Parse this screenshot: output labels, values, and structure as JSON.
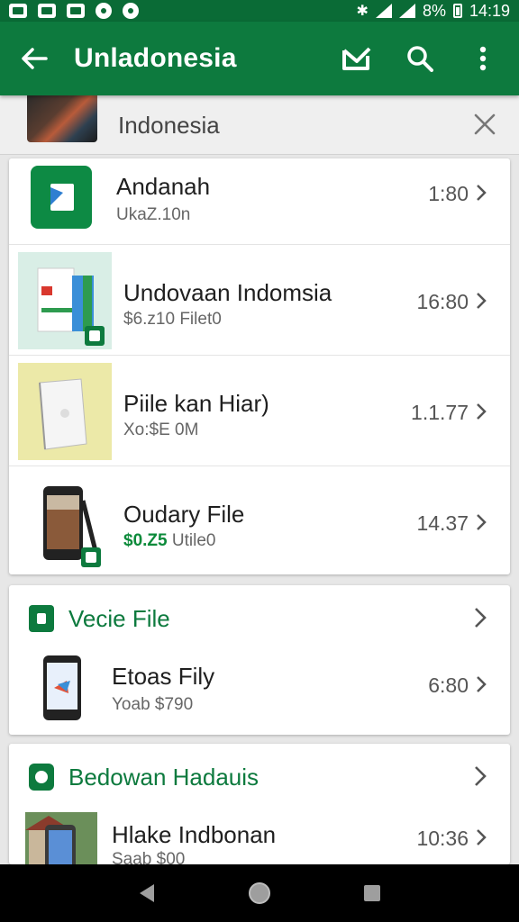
{
  "status_bar": {
    "battery_percent": "8%",
    "time": "14:19"
  },
  "app_bar": {
    "title": "Unladonesia"
  },
  "search": {
    "query": "Indonesia"
  },
  "results": [
    {
      "title": "Andanah",
      "subtitle": "UkaZ.10n",
      "value": "1:80"
    },
    {
      "title": "Undovaan Indomsia",
      "subtitle": "$6.z10 Filet0",
      "value": "16:80"
    },
    {
      "title": "Piile kan Hiar)",
      "subtitle": "Xo:$E 0M",
      "value": "1.1.77"
    },
    {
      "title": "Oudary File",
      "subtitle_price": "$0.Z5",
      "subtitle_rest": "Utile0",
      "value": "14.37"
    }
  ],
  "sections": [
    {
      "title": "Vecie File",
      "items": [
        {
          "title": "Etoas Fily",
          "subtitle": "Yoab $790",
          "value": "6:80"
        }
      ]
    },
    {
      "title": "Bedowan Hadauis",
      "items": [
        {
          "title": "Hlake Indbonan",
          "subtitle": "Saab $00",
          "value": "10:36"
        }
      ]
    }
  ],
  "colors": {
    "brand": "#0d7a3e",
    "status_bar": "#0a6b36",
    "accent_text": "#0b8a3a"
  }
}
